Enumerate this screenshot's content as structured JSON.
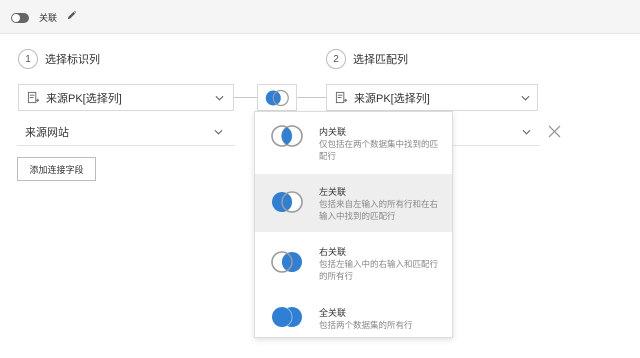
{
  "topbar": {
    "title": "关联"
  },
  "steps": [
    {
      "number": "1",
      "label": "选择标识列"
    },
    {
      "number": "2",
      "label": "选择匹配列"
    }
  ],
  "left_select": {
    "value": "来源PK[选择列]"
  },
  "right_select": {
    "value": "来源PK[选择列]"
  },
  "field_row": {
    "left_value": "来源网站"
  },
  "add_button": {
    "label": "添加连接字段"
  },
  "join_options": [
    {
      "title": "内关联",
      "description": "仅包括在两个数据集中找到的匹配行"
    },
    {
      "title": "左关联",
      "description": "包括来自左输入的所有行和在右输入中找到的匹配行"
    },
    {
      "title": "右关联",
      "description": "包括左输入中的右输入和匹配行的所有行"
    },
    {
      "title": "全关联",
      "description": "包括两个数据集的所有行"
    }
  ],
  "selected_join_index": 1,
  "colors": {
    "accent": "#2f7fd4",
    "ring": "#9a9a9a",
    "hover_bg": "#eeeeee"
  },
  "icons": [
    "toggle-icon",
    "pencil-icon",
    "column-icon",
    "chevron-down-icon",
    "join-venn-icon",
    "close-icon"
  ]
}
